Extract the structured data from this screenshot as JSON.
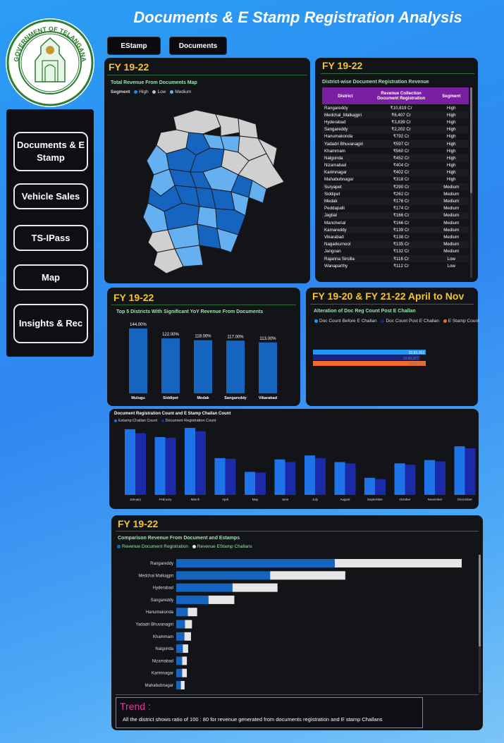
{
  "header": {
    "title": "Documents & E Stamp Registration Analysis"
  },
  "logo": {
    "text": "GOVERNMENT OF TELANGANA",
    "icon": "state-emblem-icon"
  },
  "top_buttons": {
    "estamp": "EStamp",
    "documents": "Documents"
  },
  "nav": {
    "items": [
      "Documents & E Stamp",
      "Vehicle Sales",
      "TS-IPass",
      "Map",
      "Insights & Rec"
    ]
  },
  "map_panel": {
    "fy": "FY 19-22",
    "subtitle": "Total Revenue From Documents Map",
    "legend_title": "Segment",
    "legend": [
      "High",
      "Low",
      "Medium"
    ],
    "colors": {
      "High": "#1565c0",
      "Low": "#d0d0d0",
      "Medium": "#64b0f0"
    }
  },
  "table_panel": {
    "fy": "FY 19-22",
    "subtitle": "District-wise Document Registration Revenue",
    "columns": [
      "District",
      "Revenue Collection Document Registration",
      "Segment"
    ],
    "rows": [
      [
        "Rangareddy",
        "₹10,819 Cr",
        "High"
      ],
      [
        "Medchal_Malkajgiri",
        "₹6,407 Cr",
        "High"
      ],
      [
        "Hyderabad",
        "₹3,839 Cr",
        "High"
      ],
      [
        "Sangareddy",
        "₹2,202 Cr",
        "High"
      ],
      [
        "Hanumakonda",
        "₹792 Cr",
        "High"
      ],
      [
        "Yadadri Bhuvanagiri",
        "₹597 Cr",
        "High"
      ],
      [
        "Khammam",
        "₹560 Cr",
        "High"
      ],
      [
        "Nalgonda",
        "₹452 Cr",
        "High"
      ],
      [
        "Nizamabad",
        "₹404 Cr",
        "High"
      ],
      [
        "Karimnagar",
        "₹402 Cr",
        "High"
      ],
      [
        "Mahabubnagar",
        "₹318 Cr",
        "High"
      ],
      [
        "Suryapet",
        "₹290 Cr",
        "Medium"
      ],
      [
        "Siddipet",
        "₹262 Cr",
        "Medium"
      ],
      [
        "Medak",
        "₹176 Cr",
        "Medium"
      ],
      [
        "Peddapalli",
        "₹174 Cr",
        "Medium"
      ],
      [
        "Jagtial",
        "₹166 Cr",
        "Medium"
      ],
      [
        "Mancherial",
        "₹166 Cr",
        "Medium"
      ],
      [
        "Kamareddy",
        "₹139 Cr",
        "Medium"
      ],
      [
        "Vikarabad",
        "₹138 Cr",
        "Medium"
      ],
      [
        "Nagarkurnool",
        "₹135 Cr",
        "Medium"
      ],
      [
        "Jangoan",
        "₹132 Cr",
        "Medium"
      ],
      [
        "Rajanna Sircilla",
        "₹116 Cr",
        "Low"
      ],
      [
        "Wanaparthy",
        "₹112 Cr",
        "Low"
      ]
    ]
  },
  "top5_panel": {
    "fy": "FY 19-22"
  },
  "challan_panel": {
    "fy": "FY 19-20 & FY 21-22 April to Nov"
  },
  "comparison_panel": {
    "fy": "FY 19-22"
  },
  "trend": {
    "title": "Trend :",
    "text": "All the district shows ratio of 100 : 80 for revenue generated from documents registration and E stamp Challans"
  },
  "chart_data": [
    {
      "type": "bar",
      "title": "Top 5 Districts With Significant YoY Revenue From Documents",
      "categories": [
        "Mulugu",
        "Siddipet",
        "Medak",
        "Sangareddy",
        "Vikarabad"
      ],
      "values": [
        144.0,
        122.0,
        118.0,
        117.0,
        113.0
      ],
      "data_labels": [
        "144.00%",
        "122.00%",
        "118.00%",
        "117.00%",
        "113.00%"
      ],
      "color": "#1565c0"
    },
    {
      "type": "bar",
      "orientation": "horizontal",
      "title": "Alteration of Doc Reg Count Post E Challan",
      "series": [
        {
          "name": "Doc Count Before E Challan",
          "values": [
            20833263
          ],
          "label": "20,83,263",
          "color": "#2196f3"
        },
        {
          "name": "Doc Count Post E Challan",
          "values": [
            1888207
          ],
          "label": "18,88,207",
          "color": "#1a237e"
        },
        {
          "name": "E Stamp Count",
          "values": [
            1989181
          ],
          "label": "19,89,181",
          "color": "#f26b2a"
        }
      ]
    },
    {
      "type": "bar",
      "title": "Document Registration Count and E Stamp Challan Count",
      "categories": [
        "January",
        "February",
        "March",
        "April",
        "May",
        "June",
        "July",
        "August",
        "September",
        "October",
        "November",
        "December"
      ],
      "series": [
        {
          "name": "Estamp Challan Count",
          "values": [
            100,
            88,
            102,
            56,
            35,
            54,
            60,
            50,
            26,
            48,
            53,
            74
          ],
          "color": "#1e73e8"
        },
        {
          "name": "Document Registration Count",
          "values": [
            94,
            87,
            97,
            55,
            34,
            50,
            56,
            48,
            24,
            46,
            51,
            71
          ],
          "color": "#1a2aa8"
        }
      ]
    },
    {
      "type": "bar",
      "orientation": "horizontal",
      "stacked": true,
      "title": "Comparison Revenue From Document and Estamps",
      "categories": [
        "Rangareddy",
        "Medchal Malkajgiri",
        "Hyderabad",
        "Sangareddy",
        "Hanumakonda",
        "Yadadri Bhuvanagiri",
        "Khammam",
        "Nalgonda",
        "Nizamabad",
        "Karimnagar",
        "Mahabubnagar"
      ],
      "series": [
        {
          "name": "Revenue Document Registration",
          "values": [
            10819,
            6407,
            3839,
            2202,
            792,
            597,
            560,
            452,
            404,
            402,
            318
          ],
          "color": "#1565c0"
        },
        {
          "name": "Revenue EStamp Challans",
          "values": [
            8655,
            5126,
            3071,
            1762,
            634,
            478,
            448,
            362,
            323,
            322,
            254
          ],
          "color": "#e6e6e6"
        }
      ]
    }
  ]
}
